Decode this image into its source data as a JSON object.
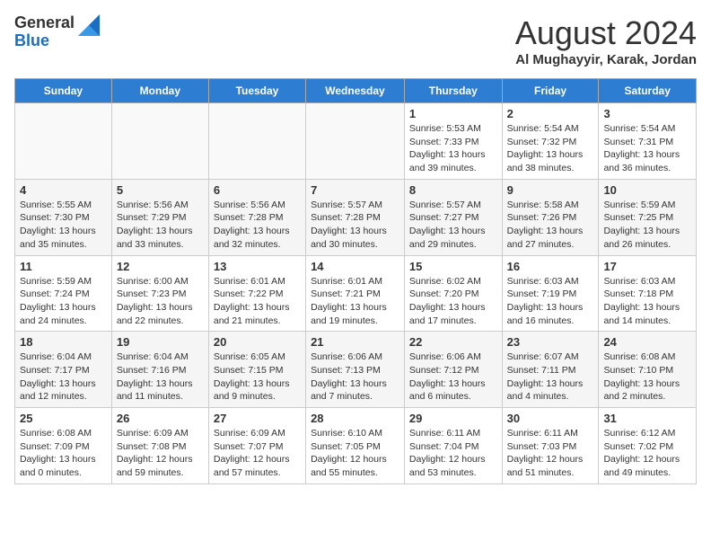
{
  "logo": {
    "general": "General",
    "blue": "Blue"
  },
  "title": "August 2024",
  "location": "Al Mughayyir, Karak, Jordan",
  "days_of_week": [
    "Sunday",
    "Monday",
    "Tuesday",
    "Wednesday",
    "Thursday",
    "Friday",
    "Saturday"
  ],
  "weeks": [
    [
      {
        "day": "",
        "info": ""
      },
      {
        "day": "",
        "info": ""
      },
      {
        "day": "",
        "info": ""
      },
      {
        "day": "",
        "info": ""
      },
      {
        "day": "1",
        "info": "Sunrise: 5:53 AM\nSunset: 7:33 PM\nDaylight: 13 hours and 39 minutes."
      },
      {
        "day": "2",
        "info": "Sunrise: 5:54 AM\nSunset: 7:32 PM\nDaylight: 13 hours and 38 minutes."
      },
      {
        "day": "3",
        "info": "Sunrise: 5:54 AM\nSunset: 7:31 PM\nDaylight: 13 hours and 36 minutes."
      }
    ],
    [
      {
        "day": "4",
        "info": "Sunrise: 5:55 AM\nSunset: 7:30 PM\nDaylight: 13 hours and 35 minutes."
      },
      {
        "day": "5",
        "info": "Sunrise: 5:56 AM\nSunset: 7:29 PM\nDaylight: 13 hours and 33 minutes."
      },
      {
        "day": "6",
        "info": "Sunrise: 5:56 AM\nSunset: 7:28 PM\nDaylight: 13 hours and 32 minutes."
      },
      {
        "day": "7",
        "info": "Sunrise: 5:57 AM\nSunset: 7:28 PM\nDaylight: 13 hours and 30 minutes."
      },
      {
        "day": "8",
        "info": "Sunrise: 5:57 AM\nSunset: 7:27 PM\nDaylight: 13 hours and 29 minutes."
      },
      {
        "day": "9",
        "info": "Sunrise: 5:58 AM\nSunset: 7:26 PM\nDaylight: 13 hours and 27 minutes."
      },
      {
        "day": "10",
        "info": "Sunrise: 5:59 AM\nSunset: 7:25 PM\nDaylight: 13 hours and 26 minutes."
      }
    ],
    [
      {
        "day": "11",
        "info": "Sunrise: 5:59 AM\nSunset: 7:24 PM\nDaylight: 13 hours and 24 minutes."
      },
      {
        "day": "12",
        "info": "Sunrise: 6:00 AM\nSunset: 7:23 PM\nDaylight: 13 hours and 22 minutes."
      },
      {
        "day": "13",
        "info": "Sunrise: 6:01 AM\nSunset: 7:22 PM\nDaylight: 13 hours and 21 minutes."
      },
      {
        "day": "14",
        "info": "Sunrise: 6:01 AM\nSunset: 7:21 PM\nDaylight: 13 hours and 19 minutes."
      },
      {
        "day": "15",
        "info": "Sunrise: 6:02 AM\nSunset: 7:20 PM\nDaylight: 13 hours and 17 minutes."
      },
      {
        "day": "16",
        "info": "Sunrise: 6:03 AM\nSunset: 7:19 PM\nDaylight: 13 hours and 16 minutes."
      },
      {
        "day": "17",
        "info": "Sunrise: 6:03 AM\nSunset: 7:18 PM\nDaylight: 13 hours and 14 minutes."
      }
    ],
    [
      {
        "day": "18",
        "info": "Sunrise: 6:04 AM\nSunset: 7:17 PM\nDaylight: 13 hours and 12 minutes."
      },
      {
        "day": "19",
        "info": "Sunrise: 6:04 AM\nSunset: 7:16 PM\nDaylight: 13 hours and 11 minutes."
      },
      {
        "day": "20",
        "info": "Sunrise: 6:05 AM\nSunset: 7:15 PM\nDaylight: 13 hours and 9 minutes."
      },
      {
        "day": "21",
        "info": "Sunrise: 6:06 AM\nSunset: 7:13 PM\nDaylight: 13 hours and 7 minutes."
      },
      {
        "day": "22",
        "info": "Sunrise: 6:06 AM\nSunset: 7:12 PM\nDaylight: 13 hours and 6 minutes."
      },
      {
        "day": "23",
        "info": "Sunrise: 6:07 AM\nSunset: 7:11 PM\nDaylight: 13 hours and 4 minutes."
      },
      {
        "day": "24",
        "info": "Sunrise: 6:08 AM\nSunset: 7:10 PM\nDaylight: 13 hours and 2 minutes."
      }
    ],
    [
      {
        "day": "25",
        "info": "Sunrise: 6:08 AM\nSunset: 7:09 PM\nDaylight: 13 hours and 0 minutes."
      },
      {
        "day": "26",
        "info": "Sunrise: 6:09 AM\nSunset: 7:08 PM\nDaylight: 12 hours and 59 minutes."
      },
      {
        "day": "27",
        "info": "Sunrise: 6:09 AM\nSunset: 7:07 PM\nDaylight: 12 hours and 57 minutes."
      },
      {
        "day": "28",
        "info": "Sunrise: 6:10 AM\nSunset: 7:05 PM\nDaylight: 12 hours and 55 minutes."
      },
      {
        "day": "29",
        "info": "Sunrise: 6:11 AM\nSunset: 7:04 PM\nDaylight: 12 hours and 53 minutes."
      },
      {
        "day": "30",
        "info": "Sunrise: 6:11 AM\nSunset: 7:03 PM\nDaylight: 12 hours and 51 minutes."
      },
      {
        "day": "31",
        "info": "Sunrise: 6:12 AM\nSunset: 7:02 PM\nDaylight: 12 hours and 49 minutes."
      }
    ]
  ]
}
